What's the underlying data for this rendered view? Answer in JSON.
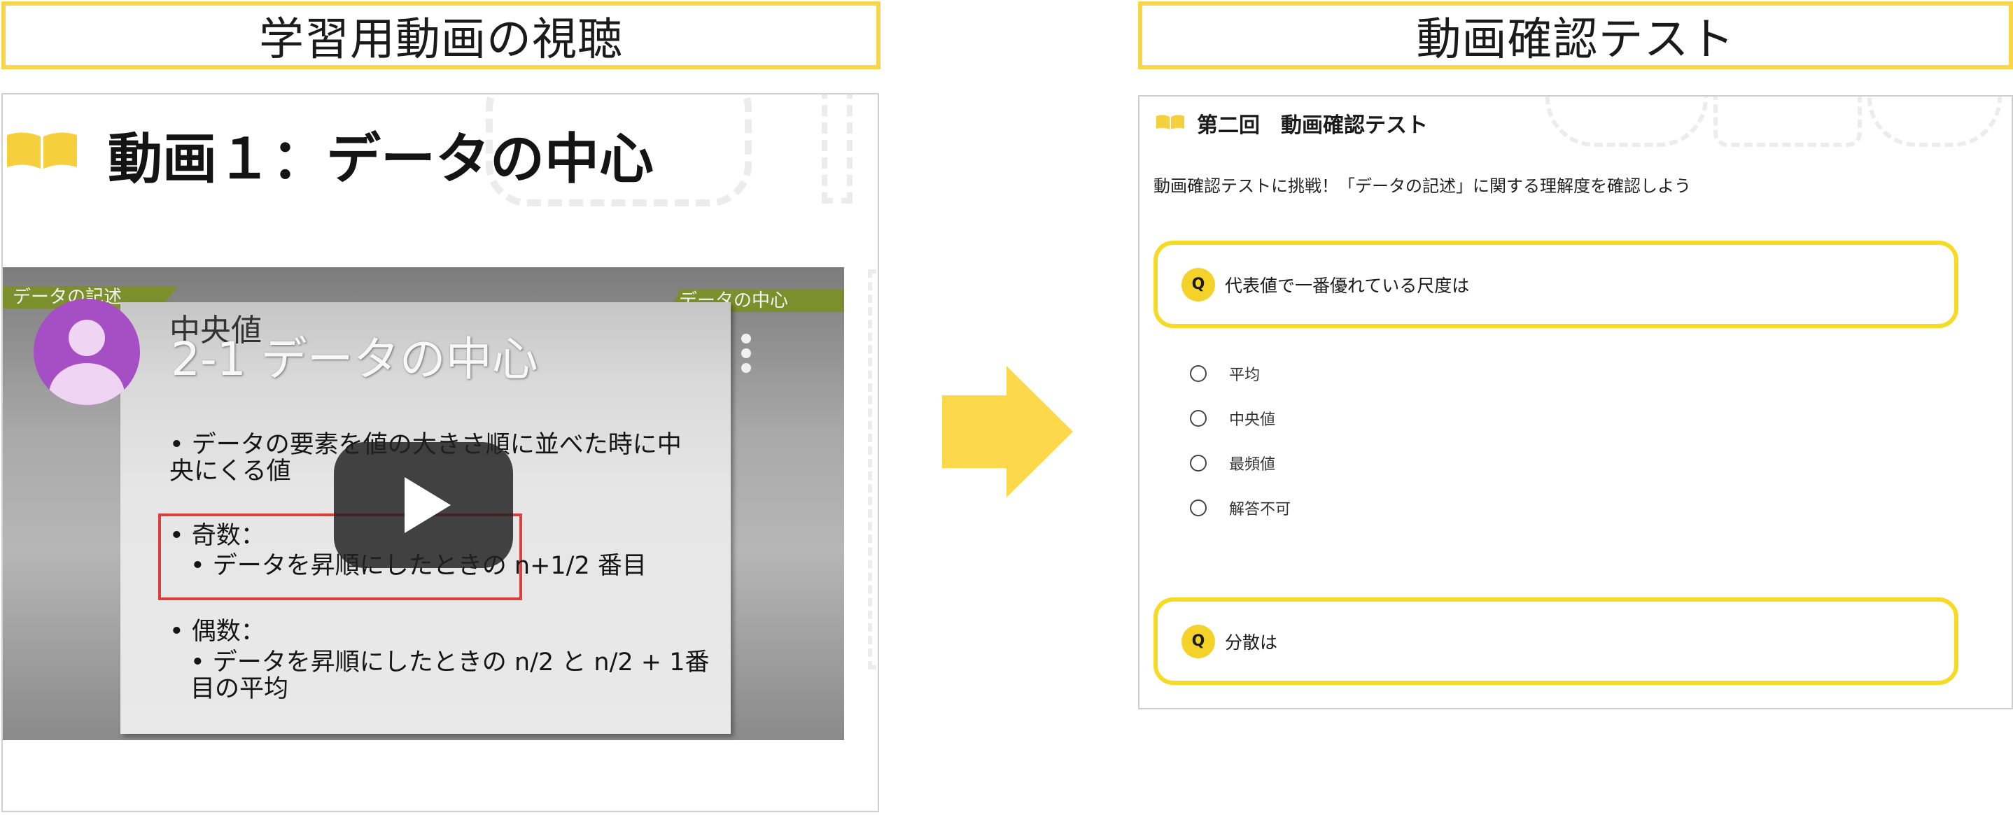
{
  "headers": {
    "left": "学習用動画の視聴",
    "right": "動画確認テスト"
  },
  "video_panel": {
    "title": "動画１：データの中心",
    "player": {
      "tag_left": "データの記述",
      "tag_right": "データの中心",
      "slide_subtitle": "中央値",
      "slide_title": "2-1 データの中心",
      "bullets": [
        "• データの要素を値の大きさ順に並べた時に中央にくる値",
        "• 奇数：",
        "• データを昇順にしたときの n+1/2 番目",
        "• 偶数：",
        "• データを昇順にしたときの n/2 と n/2 + 1番目の平均"
      ],
      "icons": [
        "channel-avatar-icon",
        "more-vert-icon",
        "play-icon"
      ]
    }
  },
  "test_panel": {
    "title": "第二回　動画確認テスト",
    "description": "動画確認テストに挑戦！「データの記述」に関する理解度を確認しよう",
    "questions": [
      {
        "badge": "Q",
        "text": "代表値で一番優れている尺度は",
        "options": [
          "平均",
          "中央値",
          "最頻値",
          "解答不可"
        ]
      },
      {
        "badge": "Q",
        "text": "分散は"
      }
    ]
  },
  "colors": {
    "accent_yellow": "#f7d64a",
    "question_border": "#f5db26",
    "arrow": "#fdd84a",
    "avatar_purple": "#a64fc4",
    "tag_green": "#7b8f2c",
    "highlight_red": "#d9403b"
  }
}
